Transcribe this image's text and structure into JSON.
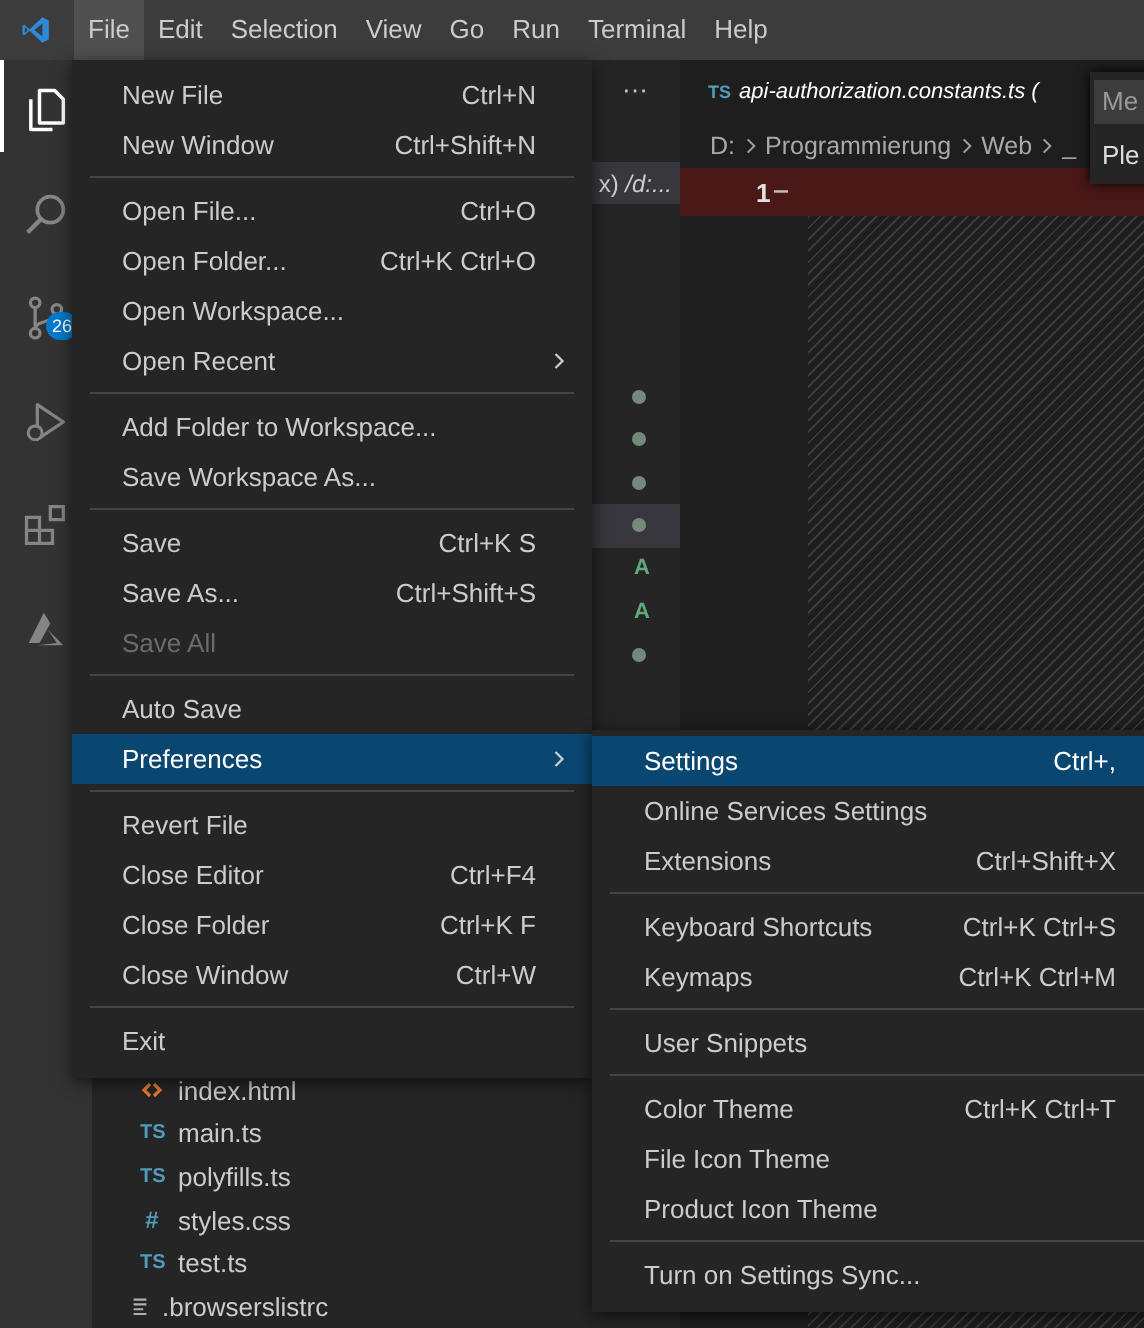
{
  "menu_bar": {
    "items": [
      {
        "label": "File",
        "selected": true
      },
      {
        "label": "Edit",
        "selected": false
      },
      {
        "label": "Selection",
        "selected": false
      },
      {
        "label": "View",
        "selected": false
      },
      {
        "label": "Go",
        "selected": false
      },
      {
        "label": "Run",
        "selected": false
      },
      {
        "label": "Terminal",
        "selected": false
      },
      {
        "label": "Help",
        "selected": false
      }
    ]
  },
  "activity_bar": {
    "source_control_badge": "26"
  },
  "sidebar": {
    "more_actions": "···",
    "open_editor": "x) */d:...*",
    "decorations": [
      {
        "kind": "dot",
        "selected": false
      },
      {
        "kind": "dot",
        "selected": false
      },
      {
        "kind": "dot",
        "selected": false
      },
      {
        "kind": "dot",
        "selected": true
      },
      {
        "kind": "letter",
        "text": "A",
        "selected": false
      },
      {
        "kind": "letter",
        "text": "A",
        "selected": false
      },
      {
        "kind": "dot",
        "selected": false
      }
    ],
    "tree": [
      {
        "children": [
          {
            "kind": "html",
            "name": "index.html"
          },
          {
            "kind": "ts",
            "icon": "TS",
            "name": "main.ts"
          },
          {
            "kind": "ts",
            "icon": "TS",
            "name": "polyfills.ts"
          },
          {
            "kind": "css",
            "icon": "#",
            "name": "styles.css"
          },
          {
            "kind": "ts",
            "icon": "TS",
            "name": "test.ts"
          }
        ]
      },
      {
        "kind": "lines",
        "name": ".browserslistrc"
      }
    ]
  },
  "editor": {
    "tab": {
      "icon": "TS",
      "title": "api-authorization.constants.ts ("
    },
    "breadcrumbs": [
      "D:",
      "Programmierung",
      "Web",
      "_"
    ],
    "line_number": "1",
    "popup": {
      "input": "Me",
      "text": "Ple"
    }
  },
  "file_menu": {
    "groups": [
      {
        "items": [
          {
            "label": "New File",
            "shortcut": "Ctrl+N",
            "disabled": false,
            "selected": false,
            "submenu": false
          },
          {
            "label": "New Window",
            "shortcut": "Ctrl+Shift+N",
            "disabled": false,
            "selected": false,
            "submenu": false
          }
        ]
      },
      {
        "items": [
          {
            "label": "Open File...",
            "shortcut": "Ctrl+O",
            "disabled": false,
            "selected": false,
            "submenu": false
          },
          {
            "label": "Open Folder...",
            "shortcut": "Ctrl+K Ctrl+O",
            "disabled": false,
            "selected": false,
            "submenu": false
          },
          {
            "label": "Open Workspace...",
            "disabled": false,
            "selected": false,
            "submenu": false
          },
          {
            "label": "Open Recent",
            "disabled": false,
            "selected": false,
            "submenu": true
          }
        ]
      },
      {
        "items": [
          {
            "label": "Add Folder to Workspace...",
            "disabled": false,
            "selected": false,
            "submenu": false
          },
          {
            "label": "Save Workspace As...",
            "disabled": false,
            "selected": false,
            "submenu": false
          }
        ]
      },
      {
        "items": [
          {
            "label": "Save",
            "shortcut": "Ctrl+K S",
            "disabled": false,
            "selected": false,
            "submenu": false
          },
          {
            "label": "Save As...",
            "shortcut": "Ctrl+Shift+S",
            "disabled": false,
            "selected": false,
            "submenu": false
          },
          {
            "label": "Save All",
            "disabled": true,
            "selected": false,
            "submenu": false
          }
        ]
      },
      {
        "items": [
          {
            "label": "Auto Save",
            "disabled": false,
            "selected": false,
            "submenu": false
          },
          {
            "label": "Preferences",
            "disabled": false,
            "selected": true,
            "submenu": true
          }
        ]
      },
      {
        "items": [
          {
            "label": "Revert File",
            "disabled": false,
            "selected": false,
            "submenu": false
          },
          {
            "label": "Close Editor",
            "shortcut": "Ctrl+F4",
            "disabled": false,
            "selected": false,
            "submenu": false
          },
          {
            "label": "Close Folder",
            "shortcut": "Ctrl+K F",
            "disabled": false,
            "selected": false,
            "submenu": false
          },
          {
            "label": "Close Window",
            "shortcut": "Ctrl+W",
            "disabled": false,
            "selected": false,
            "submenu": false
          }
        ]
      },
      {
        "items": [
          {
            "label": "Exit",
            "disabled": false,
            "selected": false,
            "submenu": false
          }
        ]
      }
    ]
  },
  "preferences_menu": {
    "groups": [
      {
        "items": [
          {
            "label": "Settings",
            "shortcut": "Ctrl+,",
            "selected": true
          },
          {
            "label": "Online Services Settings",
            "selected": false
          },
          {
            "label": "Extensions",
            "shortcut": "Ctrl+Shift+X",
            "selected": false
          }
        ]
      },
      {
        "items": [
          {
            "label": "Keyboard Shortcuts",
            "shortcut": "Ctrl+K Ctrl+S",
            "selected": false
          },
          {
            "label": "Keymaps",
            "shortcut": "Ctrl+K Ctrl+M",
            "selected": false
          }
        ]
      },
      {
        "items": [
          {
            "label": "User Snippets",
            "selected": false
          }
        ]
      },
      {
        "items": [
          {
            "label": "Color Theme",
            "shortcut": "Ctrl+K Ctrl+T",
            "selected": false
          },
          {
            "label": "File Icon Theme",
            "selected": false
          },
          {
            "label": "Product Icon Theme",
            "selected": false
          }
        ]
      },
      {
        "items": [
          {
            "label": "Turn on Settings Sync...",
            "selected": false
          }
        ]
      }
    ]
  }
}
